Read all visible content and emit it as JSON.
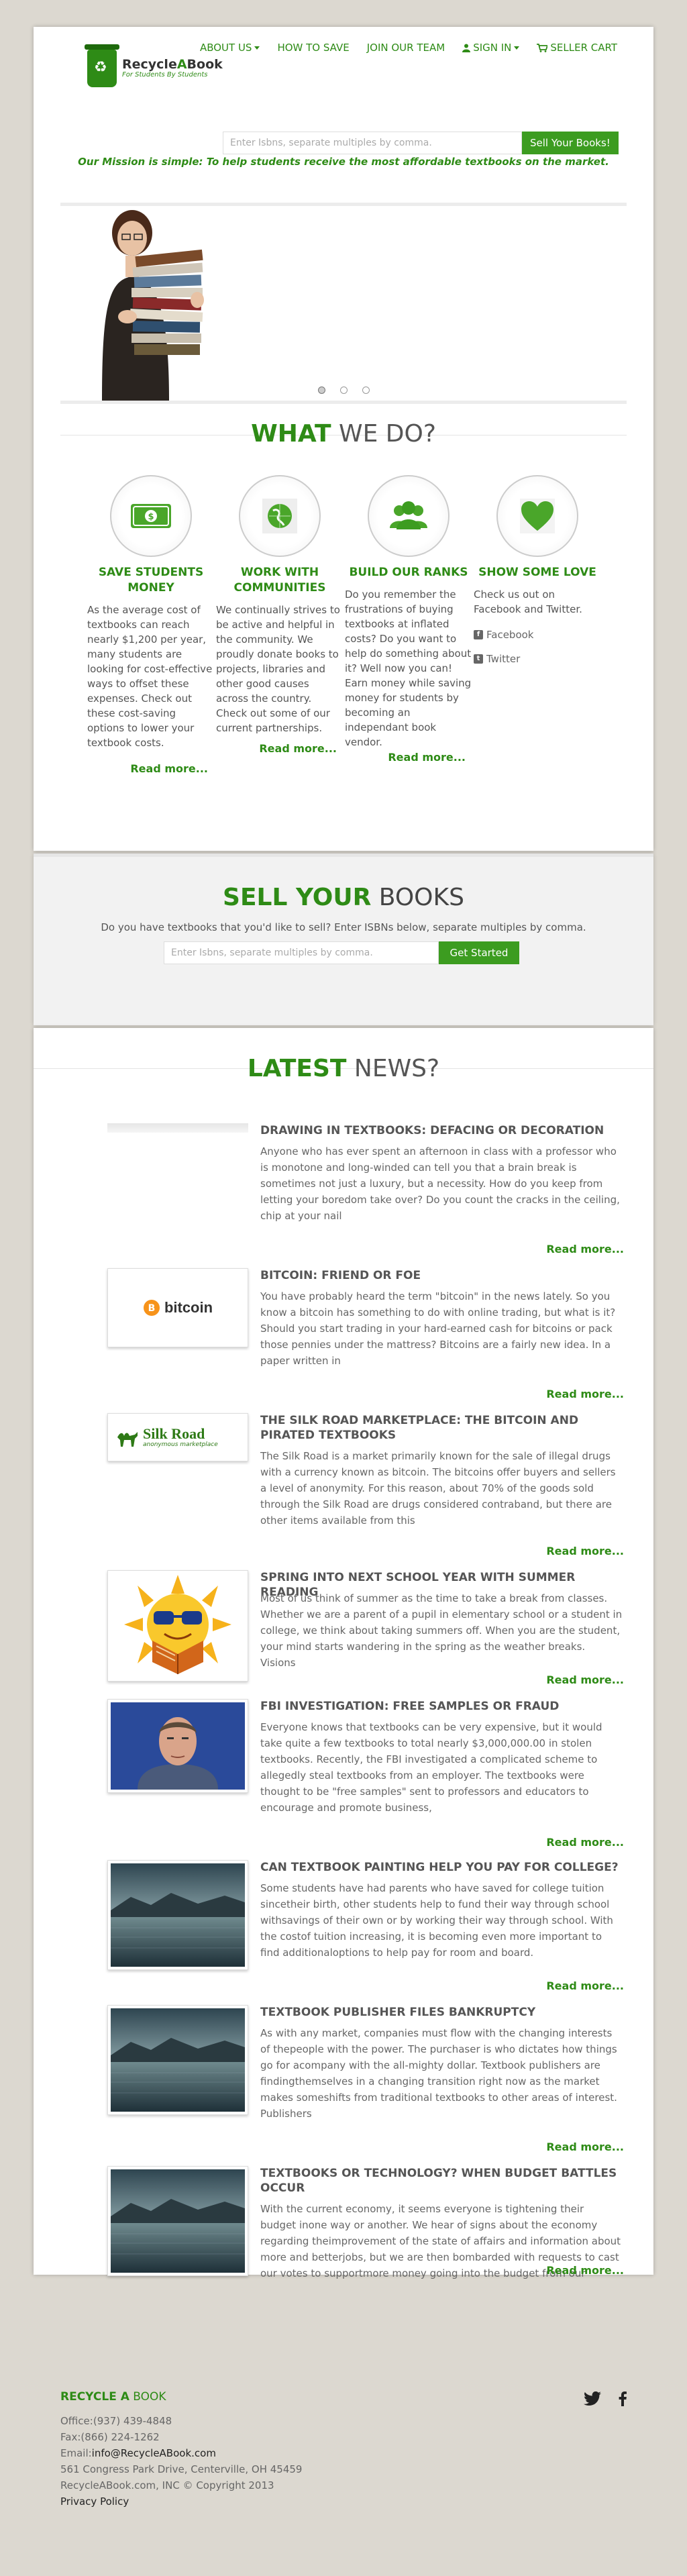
{
  "nav": {
    "items": [
      {
        "label": "ABOUT US",
        "caret": true,
        "icon": ""
      },
      {
        "label": "HOW TO SAVE",
        "caret": false,
        "icon": ""
      },
      {
        "label": "JOIN OUR TEAM",
        "caret": false,
        "icon": ""
      },
      {
        "label": "SIGN IN",
        "caret": true,
        "icon": "user-icon"
      },
      {
        "label": "SELLER CART",
        "caret": false,
        "icon": "cart-icon"
      }
    ]
  },
  "logo": {
    "name_a": "Recycle",
    "name_b": "A",
    "name_c": "Book",
    "tagline": "For Students By Students"
  },
  "search": {
    "placeholder": "Enter Isbns, separate multiples by comma.",
    "button": "Sell Your Books!"
  },
  "mission": "Our Mission is simple: To help students receive the most affordable textbooks on the market.",
  "slider": {
    "slides": 3,
    "active": 1
  },
  "what": {
    "title_bold": "WHAT",
    "title_rest": " WE DO?"
  },
  "features": [
    {
      "title": "SAVE STUDENTS MONEY",
      "text": "As the average cost of textbooks can reach nearly $1,200 per year, many students are looking for cost-effective ways to offset these expenses. Check out these cost-saving options to lower your textbook costs.",
      "more": "Read more..."
    },
    {
      "title": "WORK WITH COMMUNITIES",
      "text": "We continually strives to be active and helpful in the community. We proudly donate books to projects, libraries and other good causes across the country. Check out some of our current partnerships.",
      "more": "Read more..."
    },
    {
      "title": "BUILD OUR RANKS",
      "text": "Do you remember the frustrations of buying textbooks at inflated costs? Do you want to help do something about it? Well now you can! Earn money while saving money for students by becoming an independant book vendor.",
      "more": "Read more..."
    },
    {
      "title": "SHOW SOME LOVE",
      "text": "Check us out on Facebook and Twitter.",
      "facebook": "Facebook",
      "twitter": "Twitter"
    }
  ],
  "sell": {
    "title_bold": "SELL YOUR",
    "title_rest": " BOOKS",
    "text": "Do you have textbooks that you'd like to sell? Enter ISBNs below, separate multiples by comma.",
    "placeholder": "Enter Isbns, separate multiples by comma.",
    "button": "Get Started"
  },
  "news": {
    "title_bold": "LATEST",
    "title_rest": " NEWS?",
    "posts": [
      {
        "title": "DRAWING IN TEXTBOOKS: DEFACING OR DECORATION",
        "excerpt": "Anyone who has ever spent an afternoon in class with a professor who is monotone and long-winded can tell you that a brain break is sometimes not just a luxury, but a necessity. How do you keep from letting your boredom take over? Do you count the cracks in the ceiling, chip at your nail",
        "more": "Read more...",
        "thumb": "blank"
      },
      {
        "title": "BITCOIN: FRIEND OR FOE",
        "excerpt": "You have probably heard the term \"bitcoin\" in the news lately. So you know a bitcoin has something to do with online trading, but what is it? Should you start trading in your hard-earned cash for bitcoins or pack those pennies under the mattress? Bitcoins are a fairly new idea. In a paper written in",
        "more": "Read more...",
        "thumb": "bitcoin",
        "thumb_text": "bitcoin"
      },
      {
        "title": "THE SILK ROAD MARKETPLACE: THE BITCOIN AND PIRATED TEXTBOOKS",
        "excerpt": "The Silk Road is a market primarily known for the sale of illegal drugs with a currency known as bitcoin. The bitcoins offer buyers and sellers a level of anonymity. For this reason, about 70% of the goods sold through the Silk Road are drugs considered contraband, but there are other items available from this",
        "more": "Read more...",
        "thumb": "silkroad",
        "thumb_text": "Silk Road",
        "thumb_sub": "anonymous marketplace"
      },
      {
        "title": "SPRING INTO NEXT SCHOOL YEAR WITH SUMMER READING",
        "excerpt": "   Most of us think of summer as the time to take a break from classes. Whether we are a parent of a pupil in elementary school or a student in college, we think about taking summers off.  When you are the student, your mind starts wandering in the spring as the weather breaks.  Visions",
        "more": "Read more...",
        "thumb": "sun"
      },
      {
        "title": "FBI INVESTIGATION: FREE SAMPLES OR FRAUD",
        "excerpt": "Everyone knows that textbooks can be very expensive, but it would take quite a few textbooks to total nearly $3,000,000.00 in stolen textbooks. Recently, the FBI investigated a complicated scheme to allegedly steal textbooks from an employer. The textbooks were thought to be \"free samples\" sent to professors and educators to encourage and promote business,",
        "more": "Read more...",
        "thumb": "mugshot"
      },
      {
        "title": "CAN TEXTBOOK PAINTING HELP YOU PAY FOR COLLEGE?",
        "excerpt": "  Some students have had parents who have saved for college tuition sincetheir birth, other students help to fund their way through school withsavings of their own or by working their way through school. With the costof tuition increasing, it is becoming even more important to find additionaloptions to help pay for room and board.",
        "more": "Read more...",
        "thumb": "lake"
      },
      {
        "title": "TEXTBOOK PUBLISHER FILES BANKRUPTCY",
        "excerpt": "  As with any market, companies must flow with the changing interests of thepeople with the power.  The purchaser is who dictates how things go for acompany with the all-mighty dollar.  Textbook publishers are findingthemselves in a changing transition right now as the market makes someshifts from traditional textbooks to other areas of interest. Publishers",
        "more": "Read more...",
        "thumb": "lake"
      },
      {
        "title": "TEXTBOOKS OR TECHNOLOGY?  WHEN BUDGET BATTLES OCCUR",
        "excerpt": "With the current economy, it seems everyone is tightening their budget inone way or another.  We hear of signs about the economy regarding theimprovement of the state of affairs and information about more and betterjobs, but we are then bombarded with requests to cast our votes to supportmore money going into the budget from our",
        "more": "Read more...",
        "thumb": "lake"
      }
    ]
  },
  "footer": {
    "brand_a": "RECYCLE A",
    "brand_b": " BOOK",
    "office": "Office:(937) 439-4848",
    "fax": "Fax:(866) 224-1262",
    "email_label": "Email:",
    "email": "info@RecycleABook.com",
    "address": "561 Congress Park Drive, Centerville, OH 45459",
    "copyright": "RecycleABook.com, INC © Copyright 2013",
    "policy": "Privacy Policy"
  },
  "colors": {
    "brand_green": "#2e8b16",
    "button_green": "#3c9c20",
    "background": "#dcd8d0"
  }
}
